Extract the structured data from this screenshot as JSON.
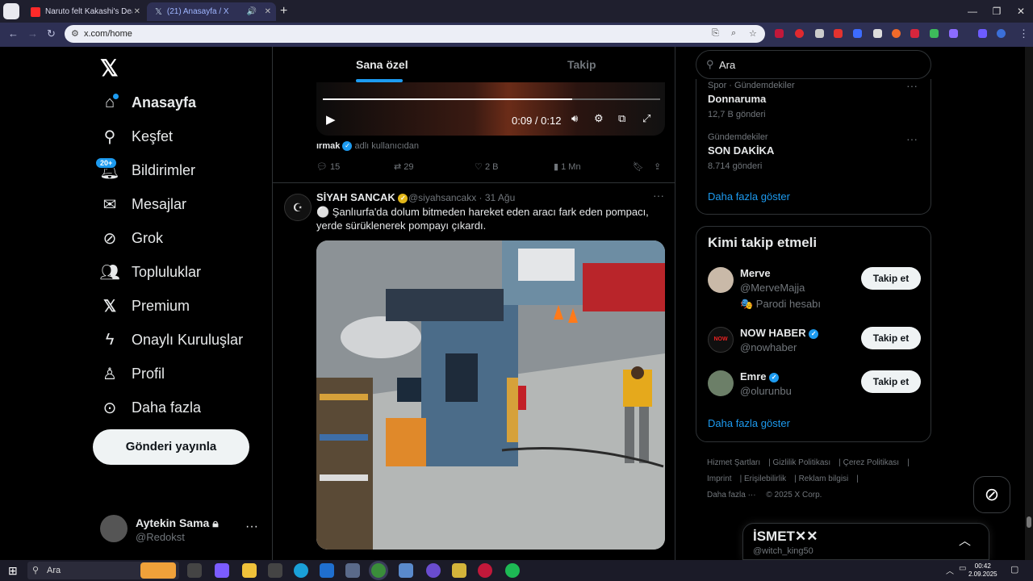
{
  "browser": {
    "tabs": [
      {
        "title": "Naruto felt Kakashi's Death Wi"
      },
      {
        "title": "(21) Anasayfa / X"
      }
    ],
    "url": "x.com/home"
  },
  "leftnav": {
    "items": [
      {
        "label": "Anasayfa",
        "icon": "home-icon"
      },
      {
        "label": "Keşfet",
        "icon": "search-icon"
      },
      {
        "label": "Bildirimler",
        "icon": "bell-icon",
        "badge": "20+"
      },
      {
        "label": "Mesajlar",
        "icon": "mail-icon"
      },
      {
        "label": "Grok",
        "icon": "grok-icon"
      },
      {
        "label": "Topluluklar",
        "icon": "people-icon"
      },
      {
        "label": "Premium",
        "icon": "x-icon"
      },
      {
        "label": "Onaylı Kuruluşlar",
        "icon": "lightning-icon"
      },
      {
        "label": "Profil",
        "icon": "person-icon"
      },
      {
        "label": "Daha fazla",
        "icon": "more-circle-icon"
      }
    ],
    "post_button": "Gönderi yayınla",
    "account": {
      "name": "Aytekin Sama",
      "handle": "@Redokst"
    }
  },
  "feed": {
    "tabs": [
      "Sana özel",
      "Takip"
    ],
    "video": {
      "time": "0:09 / 0:12",
      "progress": 0.74
    },
    "attribution": {
      "user": "ırmak",
      "suffix": "adlı kullanıcıdan"
    },
    "actions": {
      "replies": "15",
      "reposts": "29",
      "likes": "2 B",
      "views": "1 Mn"
    },
    "post": {
      "name": "SİYAH SANCAK",
      "handle": "@siyahsancakx · 31 Ağu",
      "text": "⚪ Şanlıurfa'da dolum bitmeden hareket eden aracı fark eden pompacı, yerde sürüklenerek pompayı çıkardı."
    }
  },
  "right": {
    "search_placeholder": "Ara",
    "trends": [
      {
        "category": "Spor · Gündemdekiler",
        "name": "Donnaruma",
        "count": "12,7 B gönderi"
      },
      {
        "category": "Gündemdekiler",
        "name": "SON DAKİKA",
        "count": "8.714 gönderi"
      }
    ],
    "trends_more": "Daha fazla göster",
    "follow_title": "Kimi takip etmeli",
    "follow": [
      {
        "name": "Merve",
        "handle": "@MerveMajja",
        "extra": "🎭 Parodi hesabı",
        "button": "Takip et",
        "verified": false
      },
      {
        "name": "NOW HABER",
        "handle": "@nowhaber",
        "extra": "",
        "button": "Takip et",
        "verified": true
      },
      {
        "name": "Emre",
        "handle": "@olurunbu",
        "extra": "",
        "button": "Takip et",
        "verified": true
      }
    ],
    "follow_more": "Daha fazla göster",
    "footer": [
      "Hizmet Şartları",
      "Gizlilik Politikası",
      "Çerez Politikası",
      "Imprint",
      "Erişilebilirlik",
      "Reklam bilgisi",
      "Daha fazla ···",
      "© 2025 X Corp."
    ],
    "drawer": {
      "title": "İSMET✕✕",
      "handle": "@witch_king50"
    }
  },
  "taskbar": {
    "search": "Ara",
    "time": "00:42",
    "date": "2.09.2025"
  }
}
